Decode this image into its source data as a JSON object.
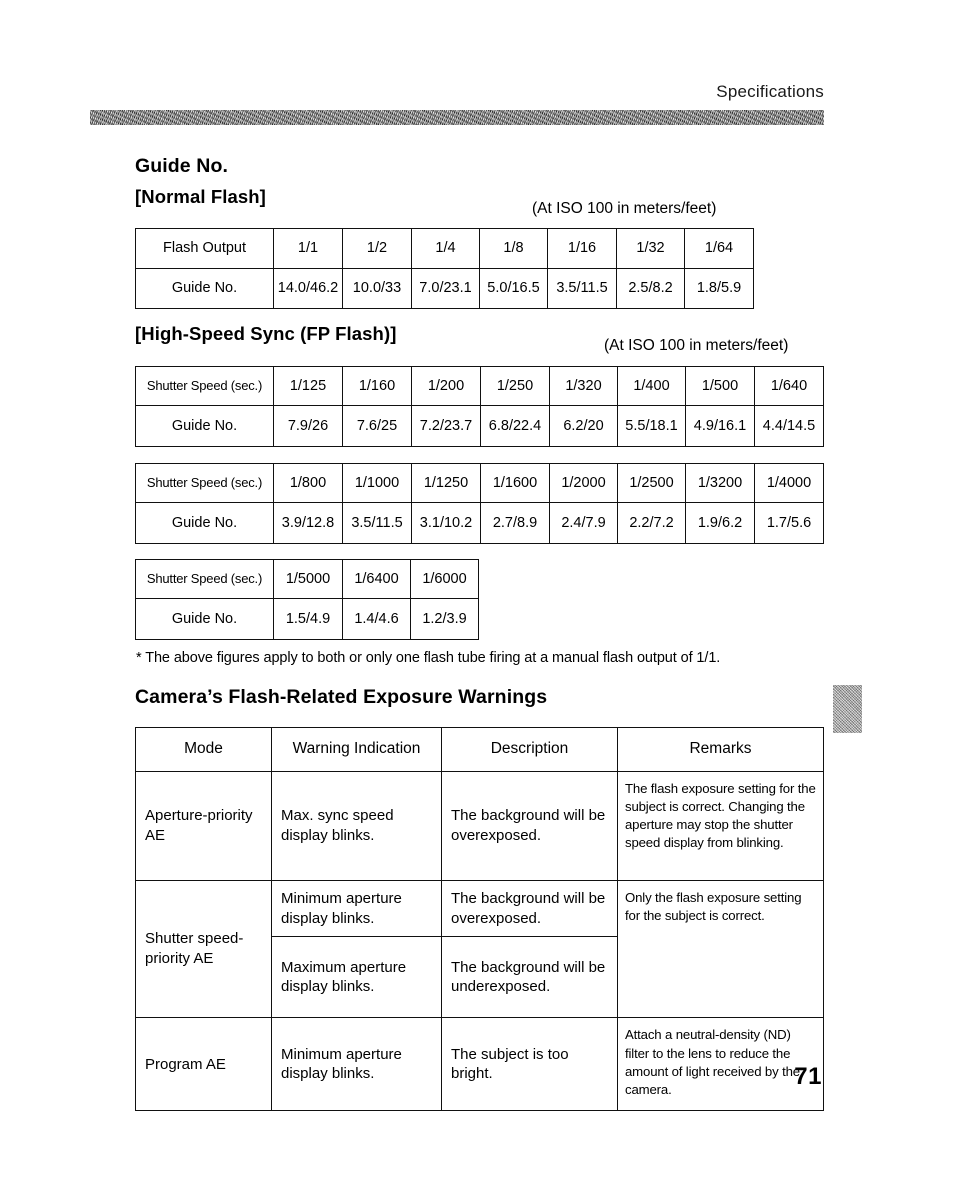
{
  "running_head": "Specifications",
  "page_number": "71",
  "sections": {
    "guide_no_title": "Guide No.",
    "normal_flash_title": "[Normal Flash]",
    "hss_title": "[High-Speed Sync (FP Flash)]",
    "iso_note_1": "(At ISO 100 in meters/feet)",
    "iso_note_2": "(At ISO 100 in meters/feet)",
    "footnote": "*  The above figures apply to both or only one flash tube firing at a manual flash output of 1/1.",
    "warnings_title": "Camera’s Flash-Related Exposure Warnings"
  },
  "normal_flash_table": {
    "row_labels": [
      "Flash Output",
      "Guide No."
    ],
    "outputs": [
      "1/1",
      "1/2",
      "1/4",
      "1/8",
      "1/16",
      "1/32",
      "1/64"
    ],
    "guide_numbers": [
      "14.0/46.2",
      "10.0/33",
      "7.0/23.1",
      "5.0/16.5",
      "3.5/11.5",
      "2.5/8.2",
      "1.8/5.9"
    ]
  },
  "hss_table_1": {
    "row_labels": [
      "Shutter Speed (sec.)",
      "Guide No."
    ],
    "shutter_speeds": [
      "1/125",
      "1/160",
      "1/200",
      "1/250",
      "1/320",
      "1/400",
      "1/500",
      "1/640"
    ],
    "guide_numbers": [
      "7.9/26",
      "7.6/25",
      "7.2/23.7",
      "6.8/22.4",
      "6.2/20",
      "5.5/18.1",
      "4.9/16.1",
      "4.4/14.5"
    ]
  },
  "hss_table_2": {
    "row_labels": [
      "Shutter Speed (sec.)",
      "Guide No."
    ],
    "shutter_speeds": [
      "1/800",
      "1/1000",
      "1/1250",
      "1/1600",
      "1/2000",
      "1/2500",
      "1/3200",
      "1/4000"
    ],
    "guide_numbers": [
      "3.9/12.8",
      "3.5/11.5",
      "3.1/10.2",
      "2.7/8.9",
      "2.4/7.9",
      "2.2/7.2",
      "1.9/6.2",
      "1.7/5.6"
    ]
  },
  "hss_table_3": {
    "row_labels": [
      "Shutter Speed (sec.)",
      "Guide No."
    ],
    "shutter_speeds": [
      "1/5000",
      "1/6400",
      "1/6000"
    ],
    "guide_numbers": [
      "1.5/4.9",
      "1.4/4.6",
      "1.2/3.9"
    ]
  },
  "warnings_table": {
    "headers": [
      "Mode",
      "Warning Indication",
      "Description",
      "Remarks"
    ],
    "rows": [
      {
        "mode": "Aperture-priority AE",
        "warning": "Max. sync speed display blinks.",
        "description": "The background will be overexposed.",
        "remarks": "The flash exposure setting for the subject is correct. Changing the aperture may stop the shutter speed display from blinking."
      },
      {
        "mode": "Shutter speed-priority AE",
        "warning": "Minimum aperture display blinks.",
        "description": "The background will be overexposed.",
        "remarks": "Only the flash exposure setting for the subject is correct."
      },
      {
        "mode": "",
        "warning": "Maximum aperture display blinks.",
        "description": "The background will be underexposed.",
        "remarks": ""
      },
      {
        "mode": "Program AE",
        "warning": "Minimum aperture display blinks.",
        "description": "The subject is too bright.",
        "remarks": "Attach a neutral-density (ND) filter to the lens to reduce the amount of light received by the camera."
      }
    ]
  },
  "colors": {
    "rule": "#111111",
    "band": "#6f6f6f",
    "thumb_tab": "#a8a8a8",
    "text": "#000000"
  }
}
